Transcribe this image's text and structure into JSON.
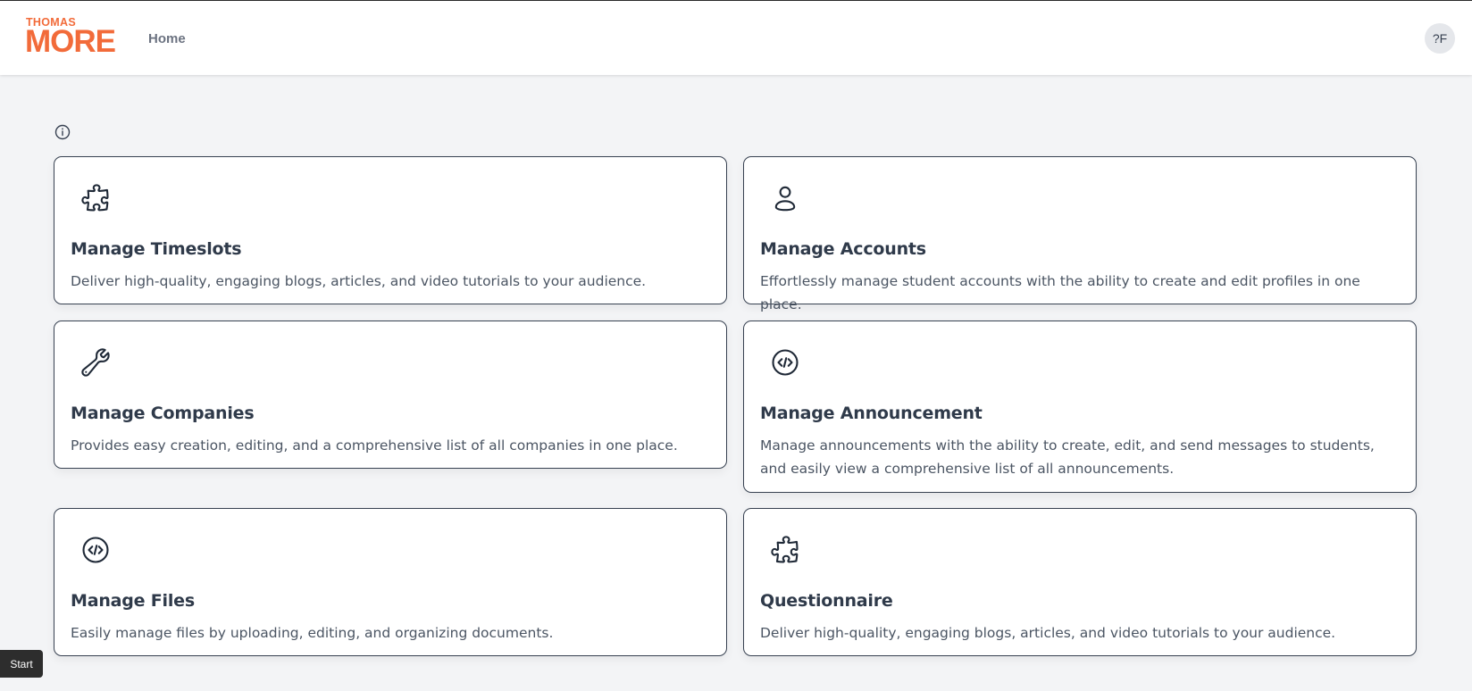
{
  "header": {
    "logo_top": "THOMAS",
    "logo_bottom": "MORE",
    "brand_color": "#f26b3a",
    "nav_home": "Home",
    "avatar_initials": "?F"
  },
  "cards": [
    {
      "title": "Manage Timeslots",
      "description": "Deliver high-quality, engaging blogs, articles, and video tutorials to your audience.",
      "icon": "puzzle-icon"
    },
    {
      "title": "Manage Accounts",
      "description": "Effortlessly manage student accounts with the ability to create and edit profiles in one place.",
      "icon": "user-icon"
    },
    {
      "title": "Manage Companies",
      "description": "Provides easy creation, editing, and a comprehensive list of all companies in one place.",
      "icon": "wrench-icon"
    },
    {
      "title": "Manage Announcement",
      "description": "Manage announcements with the ability to create, edit, and send messages to students, and easily view a comprehensive list of all announcements.",
      "icon": "code-circle-icon"
    },
    {
      "title": "Manage Files",
      "description": "Easily manage files by uploading, editing, and organizing documents.",
      "icon": "code-circle-icon"
    },
    {
      "title": "Questionnaire",
      "description": "Deliver high-quality, engaging blogs, articles, and video tutorials to your audience.",
      "icon": "puzzle-icon"
    }
  ],
  "start_label": "Start"
}
